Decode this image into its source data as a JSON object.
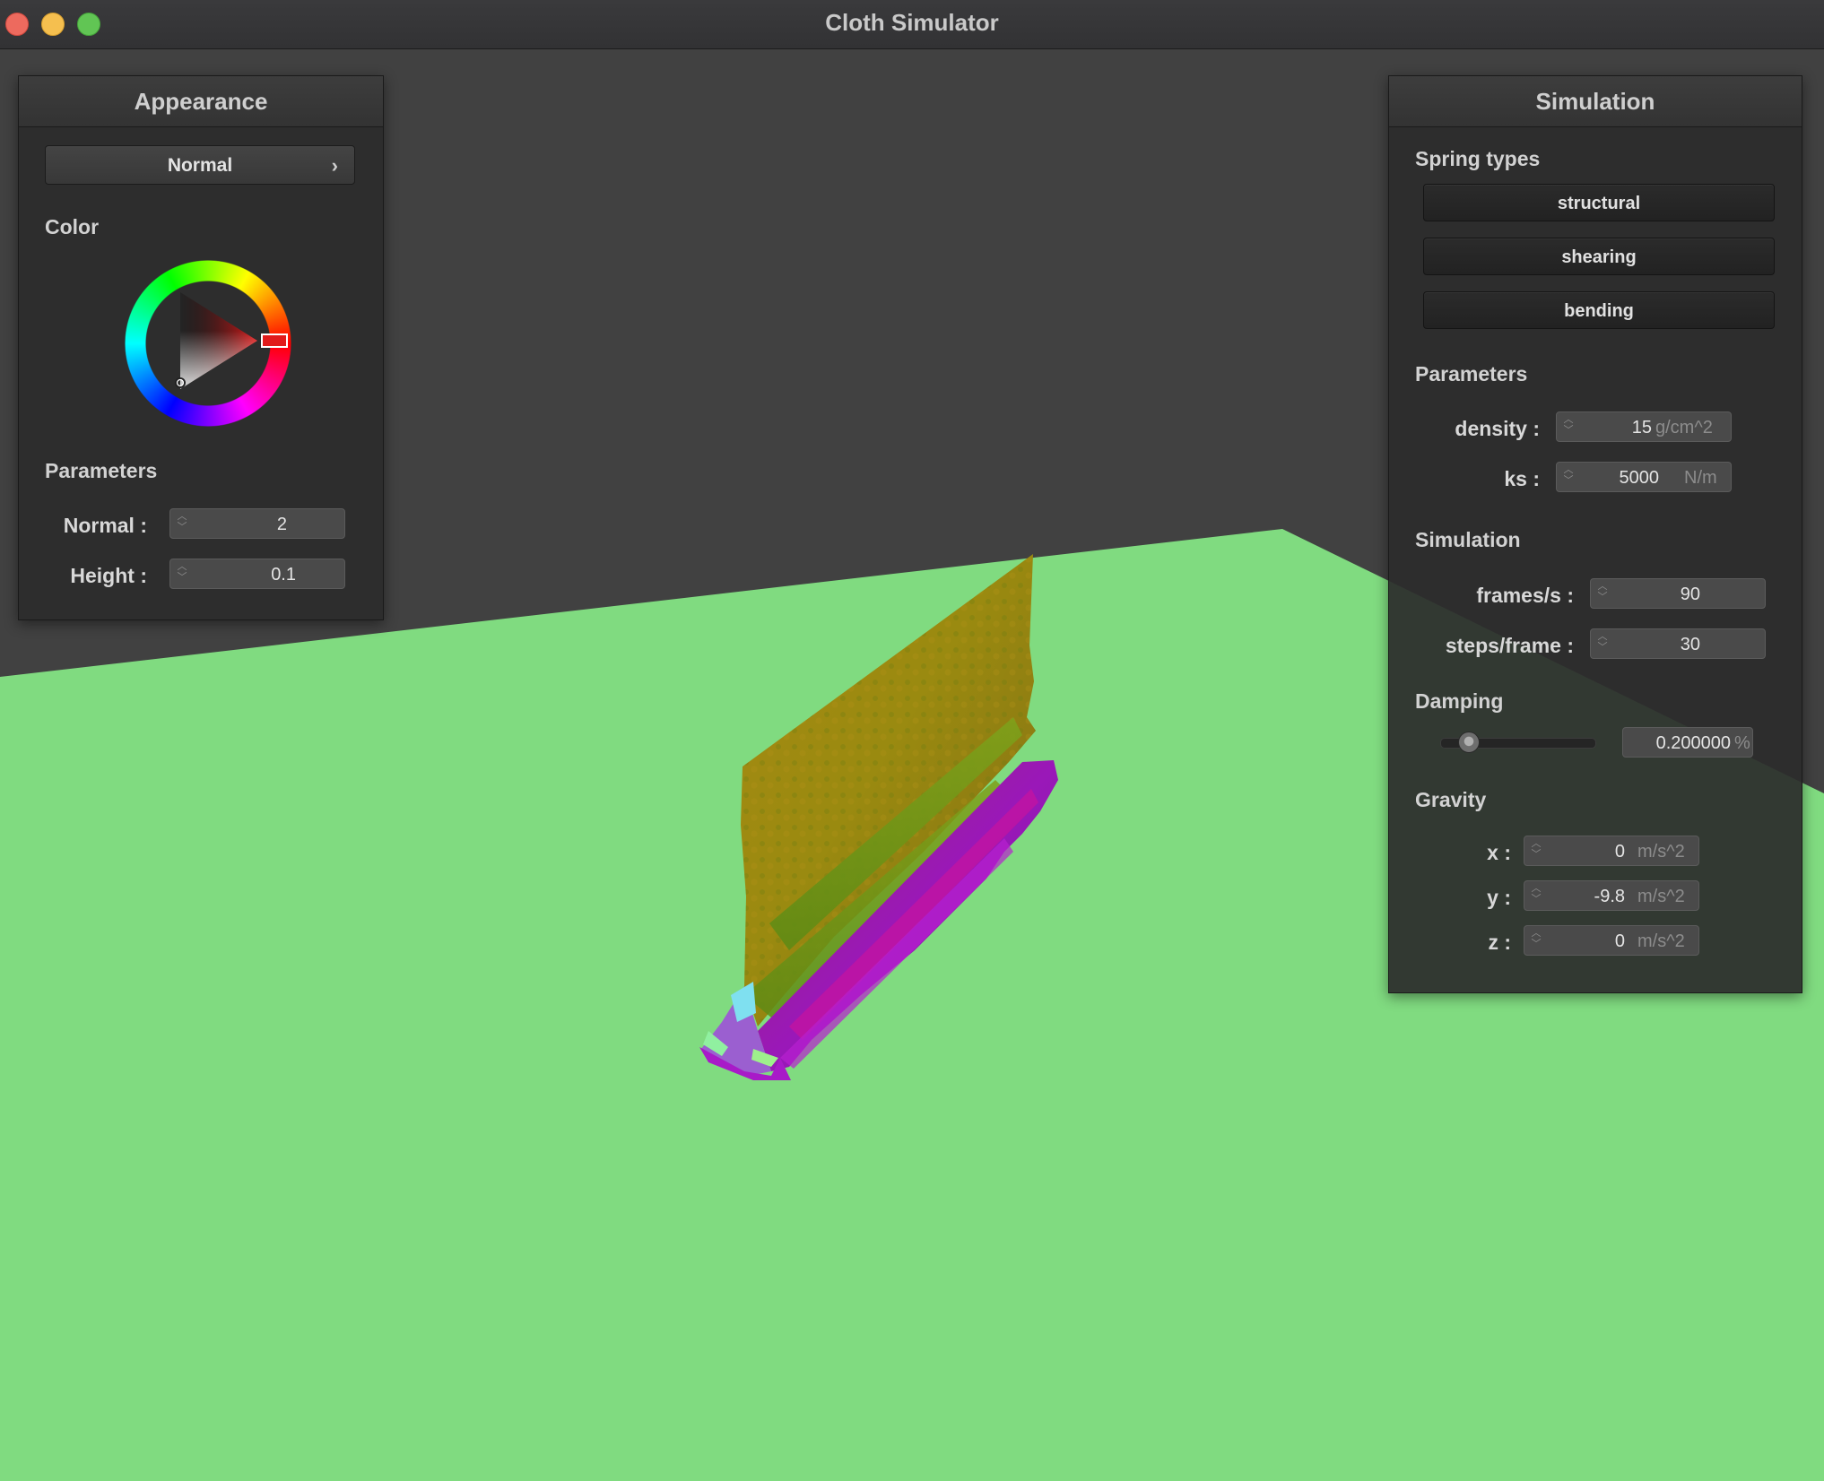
{
  "window": {
    "title": "Cloth Simulator"
  },
  "appearance": {
    "header": "Appearance",
    "shader_selected": "Normal",
    "dropdown_chevron": "›",
    "color_label": "Color",
    "parameters_label": "Parameters",
    "normal": {
      "label": "Normal :",
      "value": "2"
    },
    "height": {
      "label": "Height :",
      "value": "0.1"
    },
    "selected_color": "#e11b1b"
  },
  "simulation_panel": {
    "header": "Simulation",
    "spring_types_label": "Spring types",
    "spring_buttons": [
      "structural",
      "shearing",
      "bending"
    ],
    "parameters_label": "Parameters",
    "density": {
      "label": "density :",
      "value": "15",
      "unit": "g/cm^2"
    },
    "ks": {
      "label": "ks :",
      "value": "5000",
      "unit": "N/m"
    },
    "simulation_label": "Simulation",
    "frames_per_s": {
      "label": "frames/s :",
      "value": "90"
    },
    "steps_per_frame": {
      "label": "steps/frame :",
      "value": "30"
    },
    "damping_label": "Damping",
    "damping": {
      "value": "0.200000",
      "unit": "%",
      "slider_fraction": 0.2
    },
    "gravity_label": "Gravity",
    "gravity": {
      "x": {
        "label": "x :",
        "value": "0",
        "unit": "m/s^2"
      },
      "y": {
        "label": "y :",
        "value": "-9.8",
        "unit": "m/s^2"
      },
      "z": {
        "label": "z :",
        "value": "0",
        "unit": "m/s^2"
      }
    }
  },
  "scene": {
    "background_color": "#414141",
    "plane_color": "#80db80"
  }
}
